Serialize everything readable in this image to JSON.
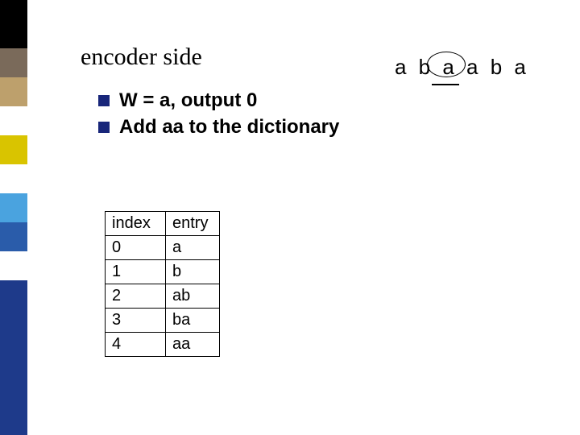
{
  "title": "encoder side",
  "bullets": [
    "W = a, output   0",
    "Add aa to the dictionary"
  ],
  "sequence": "a b a a b a",
  "table": {
    "headers": [
      "index",
      "entry"
    ],
    "rows": [
      [
        "0",
        "a"
      ],
      [
        "1",
        "b"
      ],
      [
        "2",
        "ab"
      ],
      [
        "3",
        "ba"
      ],
      [
        "4",
        "aa"
      ]
    ]
  },
  "colorbar": [
    {
      "color": "#000000",
      "h": 60
    },
    {
      "color": "#7a6a5a",
      "h": 36
    },
    {
      "color": "#bda06c",
      "h": 36
    },
    {
      "color": "#ffffff",
      "h": 36
    },
    {
      "color": "#d9c400",
      "h": 36
    },
    {
      "color": "#ffffff",
      "h": 36
    },
    {
      "color": "#4aa3df",
      "h": 36
    },
    {
      "color": "#2a5caa",
      "h": 36
    },
    {
      "color": "#ffffff",
      "h": 36
    },
    {
      "color": "#1e3a8a",
      "h": 36
    },
    {
      "color": "#1e3a8a",
      "h": 156
    }
  ]
}
